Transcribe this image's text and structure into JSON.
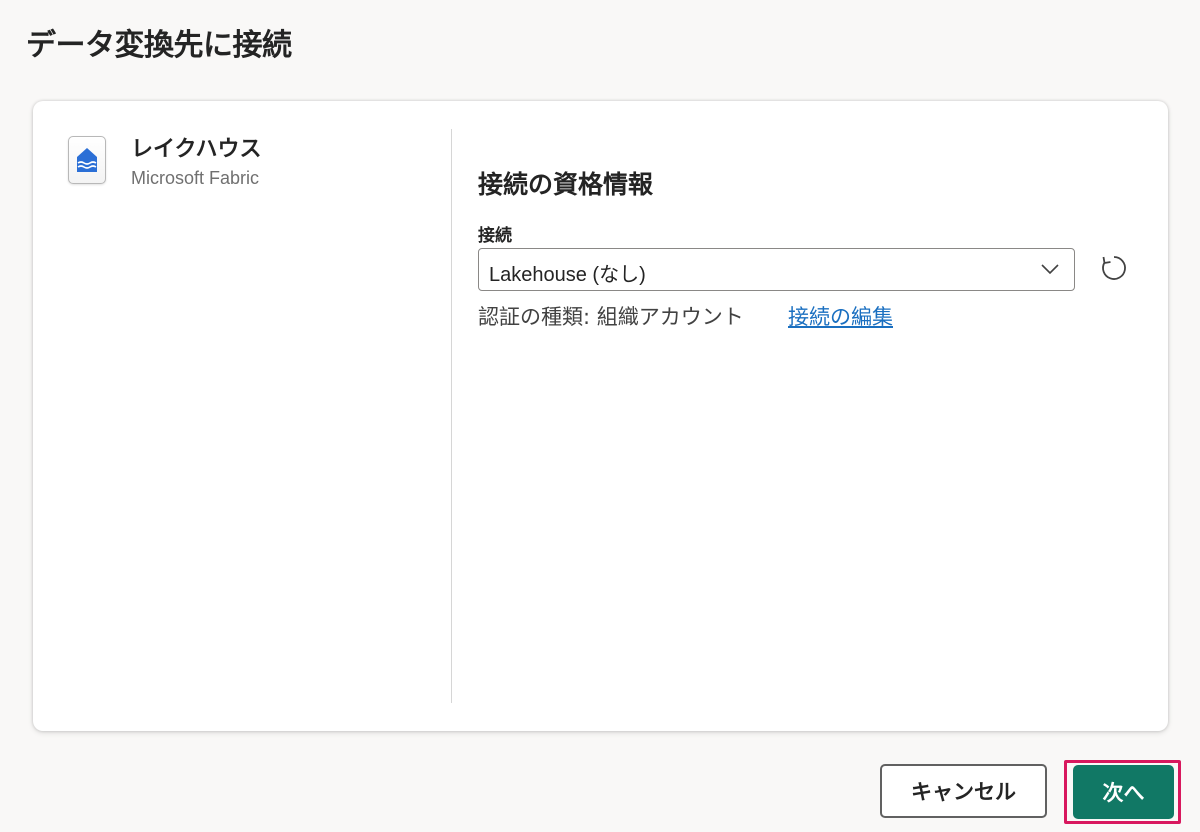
{
  "dialog": {
    "title": "データ変換先に接続"
  },
  "source": {
    "icon": "lakehouse-icon",
    "name": "レイクハウス",
    "vendor": "Microsoft Fabric"
  },
  "credentials": {
    "section_title": "接続の資格情報",
    "connection_label": "接続",
    "connection_value": "Lakehouse (なし)",
    "auth_label": "認証の種類: 組織アカウント",
    "edit_link": "接続の編集"
  },
  "footer": {
    "cancel_label": "キャンセル",
    "next_label": "次へ"
  },
  "colors": {
    "primary": "#117865",
    "link": "#1a6fc0",
    "highlight": "#d8185e",
    "background": "#f9f8f7"
  }
}
